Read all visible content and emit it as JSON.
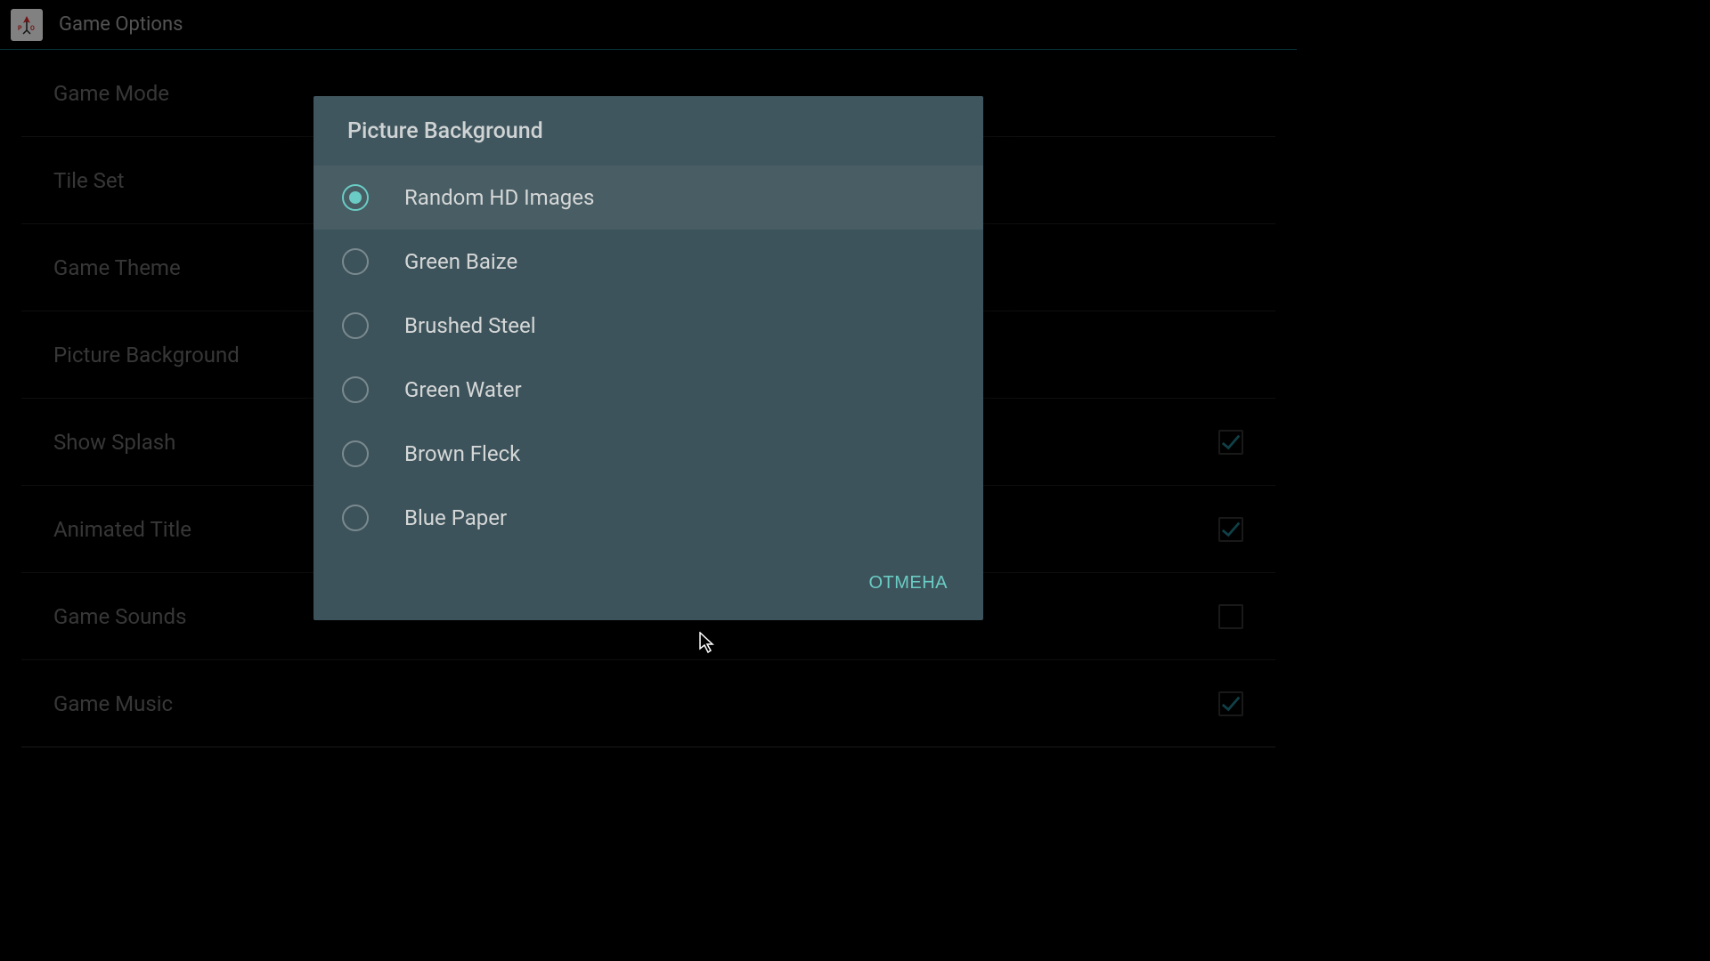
{
  "header": {
    "title": "Game Options"
  },
  "settings": [
    {
      "label": "Game Mode",
      "type": "link"
    },
    {
      "label": "Tile Set",
      "type": "link"
    },
    {
      "label": "Game Theme",
      "type": "link"
    },
    {
      "label": "Picture Background",
      "type": "link"
    },
    {
      "label": "Show Splash",
      "type": "checkbox",
      "checked": true
    },
    {
      "label": "Animated Title",
      "type": "checkbox",
      "checked": true
    },
    {
      "label": "Game Sounds",
      "type": "checkbox",
      "checked": false
    },
    {
      "label": "Game Music",
      "type": "checkbox",
      "checked": true
    }
  ],
  "dialog": {
    "title": "Picture Background",
    "options": [
      {
        "label": "Random HD Images",
        "selected": true
      },
      {
        "label": "Green Baize",
        "selected": false
      },
      {
        "label": "Brushed Steel",
        "selected": false
      },
      {
        "label": "Green Water",
        "selected": false
      },
      {
        "label": "Brown Fleck",
        "selected": false
      },
      {
        "label": "Blue Paper",
        "selected": false
      }
    ],
    "cancel_label": "ОТМЕНА"
  }
}
